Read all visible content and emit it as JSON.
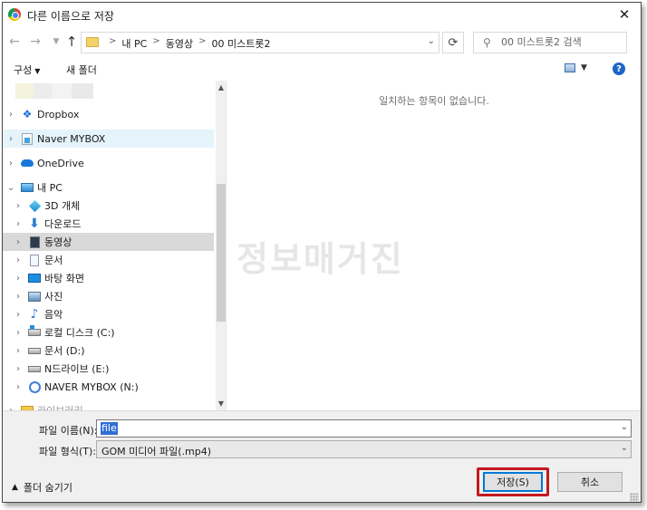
{
  "window": {
    "title": "다른 이름으로 저장",
    "close_glyph": "✕"
  },
  "address": {
    "breadcrumbs": [
      "내 PC",
      "동영상",
      "00 미스트롯2"
    ],
    "search_placeholder": "00 미스트롯2 검색"
  },
  "toolbar": {
    "organize_label": "구성",
    "new_folder_label": "새 폴더",
    "help_label": "?"
  },
  "nav_tree": {
    "items": [
      {
        "label": "Dropbox",
        "icon": "dropbox-icon"
      },
      {
        "label": "Naver MYBOX",
        "icon": "naver-mybox-icon"
      },
      {
        "label": "OneDrive",
        "icon": "onedrive-icon"
      },
      {
        "label": "내 PC",
        "icon": "pc-icon"
      },
      {
        "label": "3D 개체",
        "icon": "3d-objects-icon"
      },
      {
        "label": "다운로드",
        "icon": "download-icon"
      },
      {
        "label": "동영상",
        "icon": "videos-icon"
      },
      {
        "label": "문서",
        "icon": "documents-icon"
      },
      {
        "label": "바탕 화면",
        "icon": "desktop-icon"
      },
      {
        "label": "사진",
        "icon": "pictures-icon"
      },
      {
        "label": "음악",
        "icon": "music-icon"
      },
      {
        "label": "로컬 디스크 (C:)",
        "icon": "local-disk-icon"
      },
      {
        "label": "문서 (D:)",
        "icon": "disk-icon"
      },
      {
        "label": "N드라이브 (E:)",
        "icon": "disk-icon"
      },
      {
        "label": "NAVER MYBOX (N:)",
        "icon": "naver-mybox-drive-icon"
      },
      {
        "label": "라이브러리",
        "icon": "library-icon"
      }
    ]
  },
  "content": {
    "empty_message": "일치하는 항목이 없습니다.",
    "watermark": "정보매거진"
  },
  "form": {
    "filename_label": "파일 이름(N):",
    "filename_value": "file",
    "filetype_label": "파일 형식(T):",
    "filetype_value": "GOM 미디어 파일(.mp4)",
    "hide_folders_label": "폴더 숨기기",
    "save_label": "저장(S)",
    "cancel_label": "취소"
  },
  "colors": {
    "selection_blue": "#2f6fd6",
    "highlight_red": "#c3191f",
    "help_blue": "#1e64c8"
  }
}
